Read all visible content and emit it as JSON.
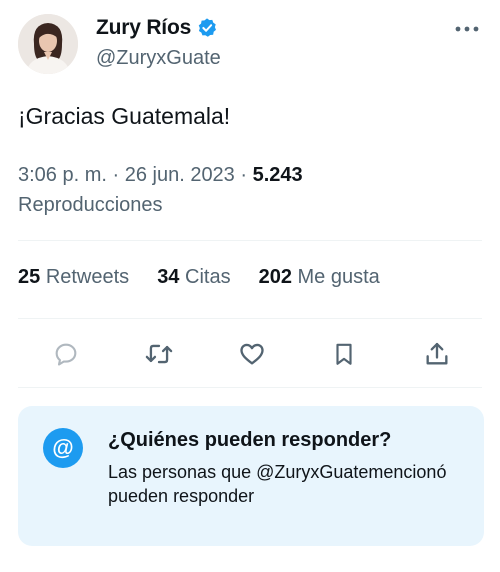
{
  "author": {
    "display_name": "Zury Ríos",
    "handle": "@ZuryxGuate"
  },
  "tweet": {
    "text": "¡Gracias Guatemala!",
    "time": "3:06 p. m. · 26 jun. 2023 · ",
    "views_count": "5.243",
    "views_label": "Reproducciones"
  },
  "stats": [
    {
      "count": "25",
      "label": "Retweets"
    },
    {
      "count": "34",
      "label": "Citas"
    },
    {
      "count": "202",
      "label": "Me gusta"
    }
  ],
  "actions": [
    "reply-icon",
    "retweet-icon",
    "like-icon",
    "bookmark-icon",
    "share-icon"
  ],
  "reply_restriction": {
    "icon": "@",
    "title": "¿Quiénes pueden responder?",
    "description": "Las personas que @ZuryxGuatemencionó pueden responder"
  },
  "colors": {
    "accent": "#1d9bf0",
    "text_primary": "#0f1419",
    "text_secondary": "#536471",
    "reply_box_bg": "#e8f5fd"
  }
}
